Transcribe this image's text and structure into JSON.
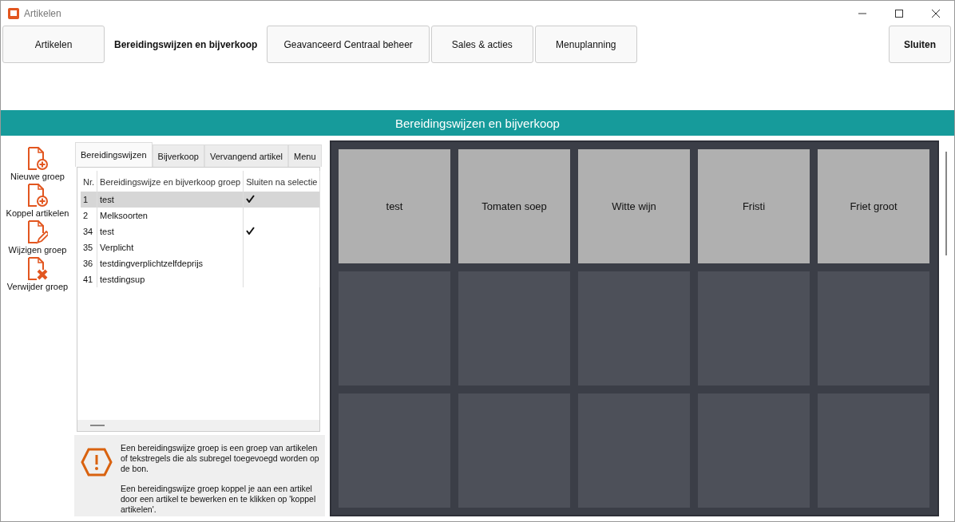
{
  "window": {
    "title": "Artikelen"
  },
  "nav": [
    {
      "label": "Artikelen",
      "selected": false
    },
    {
      "label": "Bereidingswijzen en bijverkoop",
      "selected": true
    },
    {
      "label": "Geavanceerd Centraal beheer",
      "selected": false
    },
    {
      "label": "Sales & acties",
      "selected": false
    },
    {
      "label": "Menuplanning",
      "selected": false
    }
  ],
  "close_button": "Sluiten",
  "header": "Bereidingswijzen en bijverkoop",
  "actions": [
    {
      "label": "Nieuwe groep",
      "kind": "add"
    },
    {
      "label": "Koppel artikelen",
      "kind": "add"
    },
    {
      "label": "Wijzigen groep",
      "kind": "edit"
    },
    {
      "label": "Verwijder groep",
      "kind": "delete"
    }
  ],
  "tabs": [
    {
      "label": "Bereidingswijzen",
      "selected": true
    },
    {
      "label": "Bijverkoop",
      "selected": false
    },
    {
      "label": "Vervangend artikel",
      "selected": false
    },
    {
      "label": "Menu",
      "selected": false
    }
  ],
  "table": {
    "columns": [
      "Nr.",
      "Bereidingswijze en bijverkoop groep",
      "Sluiten na selectie"
    ],
    "rows": [
      {
        "nr": "1",
        "name": "test",
        "checked": true,
        "selected": true
      },
      {
        "nr": "2",
        "name": "Melksoorten",
        "checked": false,
        "selected": false
      },
      {
        "nr": "34",
        "name": "test",
        "checked": true,
        "selected": false
      },
      {
        "nr": "35",
        "name": "Verplicht",
        "checked": false,
        "selected": false
      },
      {
        "nr": "36",
        "name": "testdingverplichtzelfdeprijs",
        "checked": false,
        "selected": false
      },
      {
        "nr": "41",
        "name": "testdingsup",
        "checked": false,
        "selected": false
      }
    ]
  },
  "info": [
    "Een bereidingswijze groep is een groep van artikelen of tekstregels die als subregel toegevoegd worden op de bon.",
    "Een bereidingswijze groep koppel je aan een artikel door een artikel te bewerken en te klikken op 'koppel artikelen'."
  ],
  "tiles": [
    {
      "kind": "item",
      "label": "test"
    },
    {
      "kind": "item",
      "label": "Tomaten soep"
    },
    {
      "kind": "item",
      "label": "Witte wijn"
    },
    {
      "kind": "item",
      "label": "Fristi"
    },
    {
      "kind": "item",
      "label": "Friet groot"
    },
    {
      "kind": "empty"
    },
    {
      "kind": "empty"
    },
    {
      "kind": "empty"
    },
    {
      "kind": "empty"
    },
    {
      "kind": "empty"
    },
    {
      "kind": "empty"
    },
    {
      "kind": "empty"
    },
    {
      "kind": "empty"
    },
    {
      "kind": "empty"
    },
    {
      "kind": "empty"
    }
  ]
}
